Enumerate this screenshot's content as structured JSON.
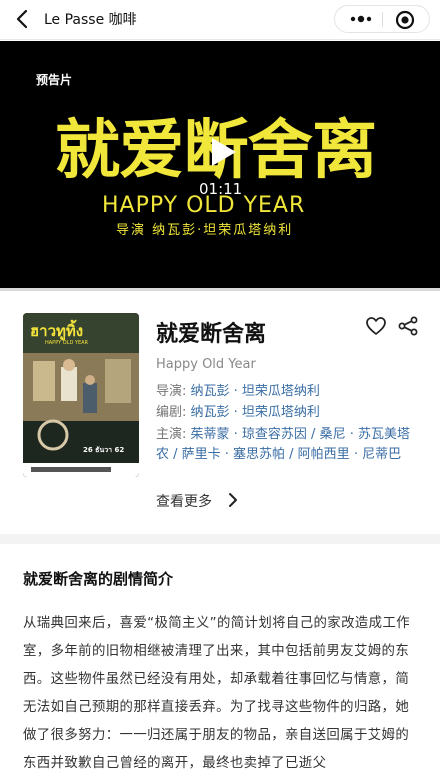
{
  "nav": {
    "title": "Le Passe 咖啡",
    "icons": {
      "back": "chevron-left-icon",
      "more": "more-dots-icon",
      "close": "target-close-icon"
    }
  },
  "video": {
    "label": "预告片",
    "title_art_cn": "就爱断舍离",
    "title_art_en": "HAPPY OLD YEAR",
    "title_art_credit": "导演 纳瓦彭·坦荣瓜塔纳利",
    "time": "01:11",
    "progress": 0.0,
    "accent_color": "#f1e63a"
  },
  "poster": {
    "title": "ฮาวทูทิ้ง",
    "subtitle": "HAPPY OLD YEAR",
    "date": "26 ธันวา 62"
  },
  "movie": {
    "title": "就爱断舍离",
    "en_title": "Happy Old Year",
    "director_label": "导演:",
    "director": "纳瓦彭 · 坦荣瓜塔纳利",
    "writer_label": "编剧:",
    "writer": "纳瓦彭 · 坦荣瓜塔纳利",
    "cast_label": "主演:",
    "cast": "茱蒂蒙 · 琼查容苏因 / 桑尼 · 苏瓦美塔农 / 萨里卡 · 塞思苏帕 / 阿帕西里 · 尼蒂巴",
    "see_more": "查看更多",
    "link_color": "#3a6ea5"
  },
  "synopsis": {
    "title": "就爱断舍离的剧情简介",
    "text": "从瑞典回来后，喜爱“极简主义”的简计划将自己的家改造成工作室，多年前的旧物相继被清理了出来，其中包括前男友艾姆的东西。这些物件虽然已经没有用处，却承载着往事回忆与情意，简无法如自己预期的那样直接丢弃。为了找寻这些物件的归路，她做了很多努力：一一归还属于朋友的物品，亲自送回属于艾姆的东西并致歉自己曾经的离开，最终也卖掉了已逝父"
  }
}
